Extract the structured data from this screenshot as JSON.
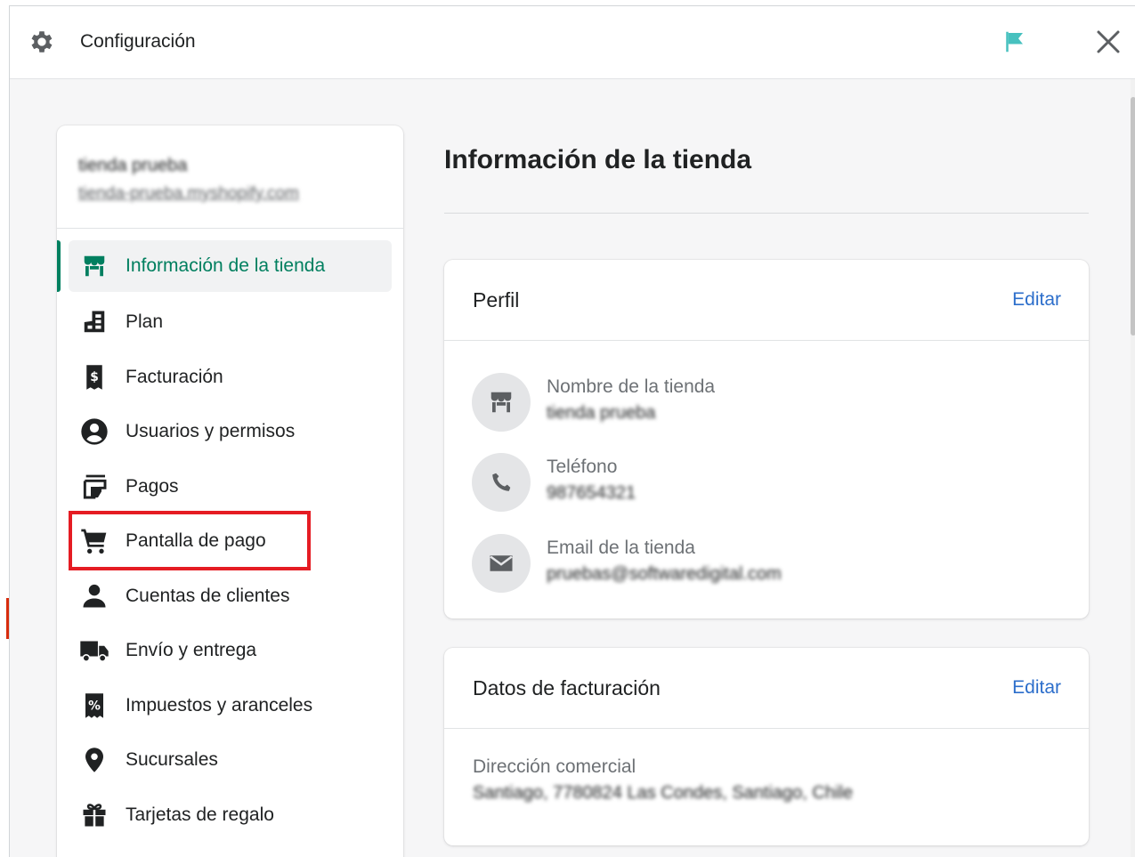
{
  "window": {
    "title": "Configuración",
    "icons": {
      "settings": "gear-icon",
      "flag": "flag-icon",
      "close": "close-icon"
    }
  },
  "sidebar": {
    "store_name": "tienda prueba",
    "store_url": "tienda-prueba.myshopify.com",
    "items": [
      {
        "label": "Información de la tienda",
        "icon": "store-icon",
        "active": true
      },
      {
        "label": "Plan",
        "icon": "plan-icon"
      },
      {
        "label": "Facturación",
        "icon": "billing-icon"
      },
      {
        "label": "Usuarios y permisos",
        "icon": "user-circle-icon"
      },
      {
        "label": "Pagos",
        "icon": "payments-icon"
      },
      {
        "label": "Pantalla de pago",
        "icon": "cart-icon",
        "highlighted": true
      },
      {
        "label": "Cuentas de clientes",
        "icon": "customer-icon"
      },
      {
        "label": "Envío y entrega",
        "icon": "truck-icon"
      },
      {
        "label": "Impuestos y aranceles",
        "icon": "tax-icon"
      },
      {
        "label": "Sucursales",
        "icon": "location-icon"
      },
      {
        "label": "Tarjetas de regalo",
        "icon": "gift-icon"
      }
    ]
  },
  "main": {
    "title": "Información de la tienda",
    "profile": {
      "title": "Perfil",
      "edit_label": "Editar",
      "store_name_label": "Nombre de la tienda",
      "store_name_value": "tienda prueba",
      "phone_label": "Teléfono",
      "phone_value": "987654321",
      "email_label": "Email de la tienda",
      "email_value": "pruebas@softwaredigital.com"
    },
    "billing": {
      "title": "Datos de facturación",
      "edit_label": "Editar",
      "address_label": "Dirección comercial",
      "address_value": "Santiago, 7780824 Las Condes, Santiago, Chile"
    }
  },
  "colors": {
    "accent_green": "#008060",
    "link_blue": "#2c6ecb",
    "highlight_red": "#e51c23",
    "flag_teal": "#47c1bf"
  }
}
